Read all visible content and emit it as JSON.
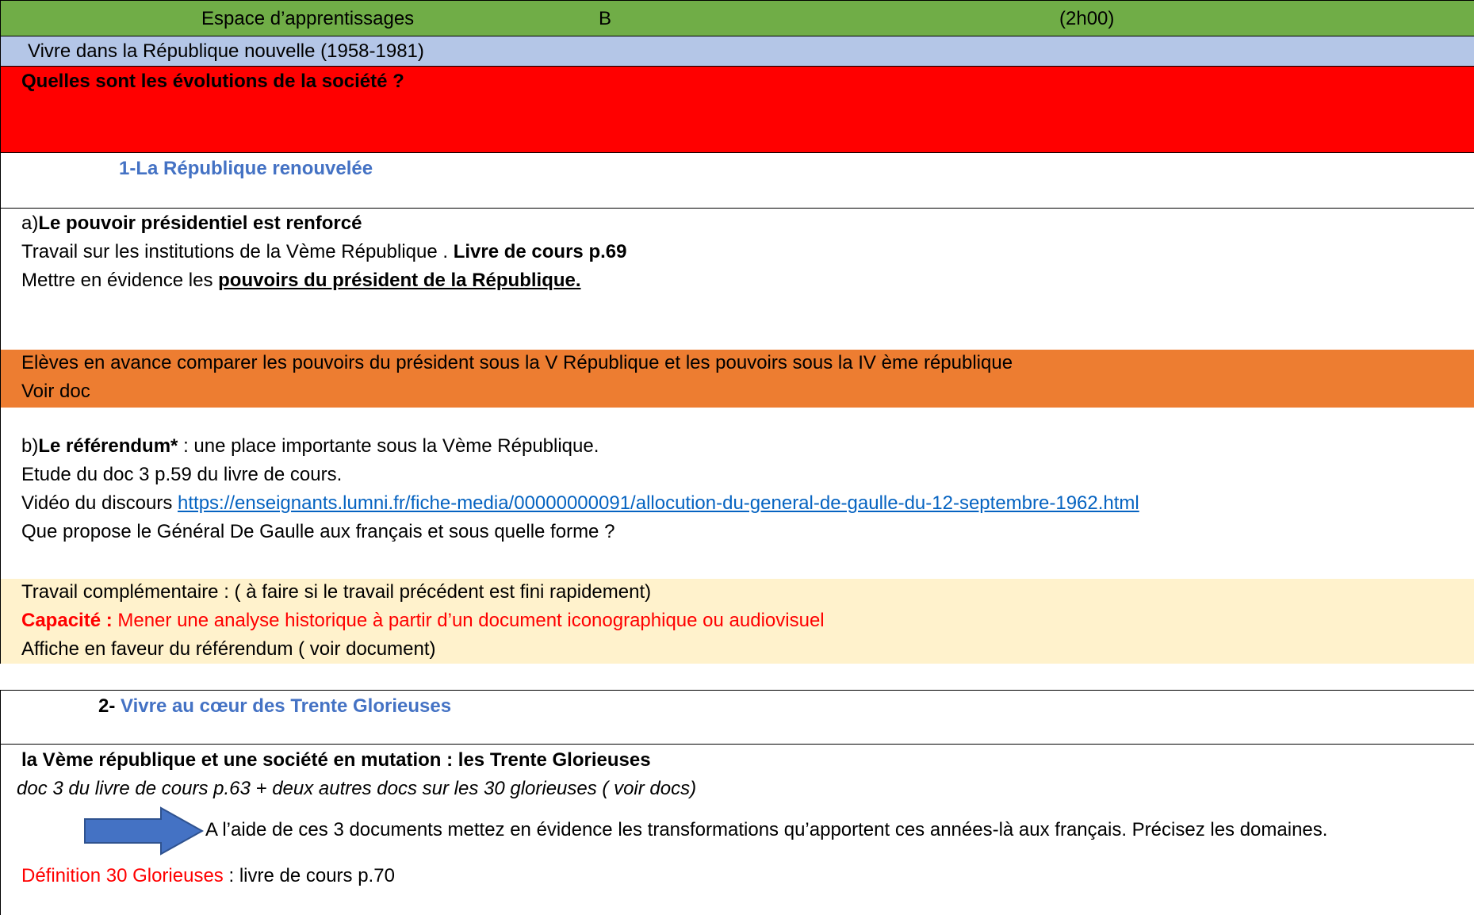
{
  "header": {
    "espace": "Espace d’apprentissages",
    "groupe": "B",
    "duree": "(2h00)"
  },
  "theme": "Vivre dans la République nouvelle (1958-1981)",
  "question": "Quelles sont les évolutions de la société ?",
  "section1": {
    "title": "1-La République renouvelée",
    "a_prefix": "a)",
    "a_title": "Le pouvoir présidentiel est renforcé",
    "line1_text": "Travail sur les institutions de la Vème République . ",
    "line1_bold": "Livre de cours p.69",
    "line2_text": "Mettre en évidence les ",
    "line2_bold": "pouvoirs du président de la République.",
    "advance_line1": "Elèves en avance  comparer les pouvoirs du président sous la V République et les pouvoirs sous la IV ème république",
    "advance_line2": "Voir doc",
    "b_prefix": "b)",
    "b_title": "Le référendum*",
    "b_rest": " : une place importante sous la Vème République.",
    "etude": "Etude du doc 3 p.59 du livre de cours.",
    "video_label": "Vidéo du discours  ",
    "video_link": "https://enseignants.lumni.fr/fiche-media/00000000091/allocution-du-general-de-gaulle-du-12-septembre-1962.html",
    "question_b": "Que propose le Général De Gaulle aux français et sous quelle forme ?",
    "compl_line1": "Travail complémentaire : ( à faire si le travail précédent est fini  rapidement)",
    "capacite_label": "Capacité :",
    "capacite_text": " Mener une analyse historique à partir d’un document iconographique ou audiovisuel",
    "affiche": "Affiche en faveur du référendum ( voir document)"
  },
  "section2": {
    "num": "2-",
    "title": " Vivre au cœur des Trente Glorieuses",
    "subtitle": "la Vème république et une société en mutation :  les Trente Glorieuses",
    "docs": " doc 3 du livre de cours p.63 + deux autres docs sur les 30 glorieuses ( voir docs)",
    "consigne": "A l’aide de ces 3 documents mettez en évidence les transformations qu’apportent ces années-là aux français. Précisez les domaines.",
    "def_label": "Définition 30 Glorieuses",
    "def_rest": " : livre de cours p.70"
  },
  "colors": {
    "header_green": "#70ad47",
    "theme_blue": "#b4c6e7",
    "question_red": "#ff0000",
    "advance_orange": "#ed7d31",
    "compl_cream": "#fff2cc",
    "section_blue": "#4472c4",
    "arrow_blue": "#4472c4"
  }
}
